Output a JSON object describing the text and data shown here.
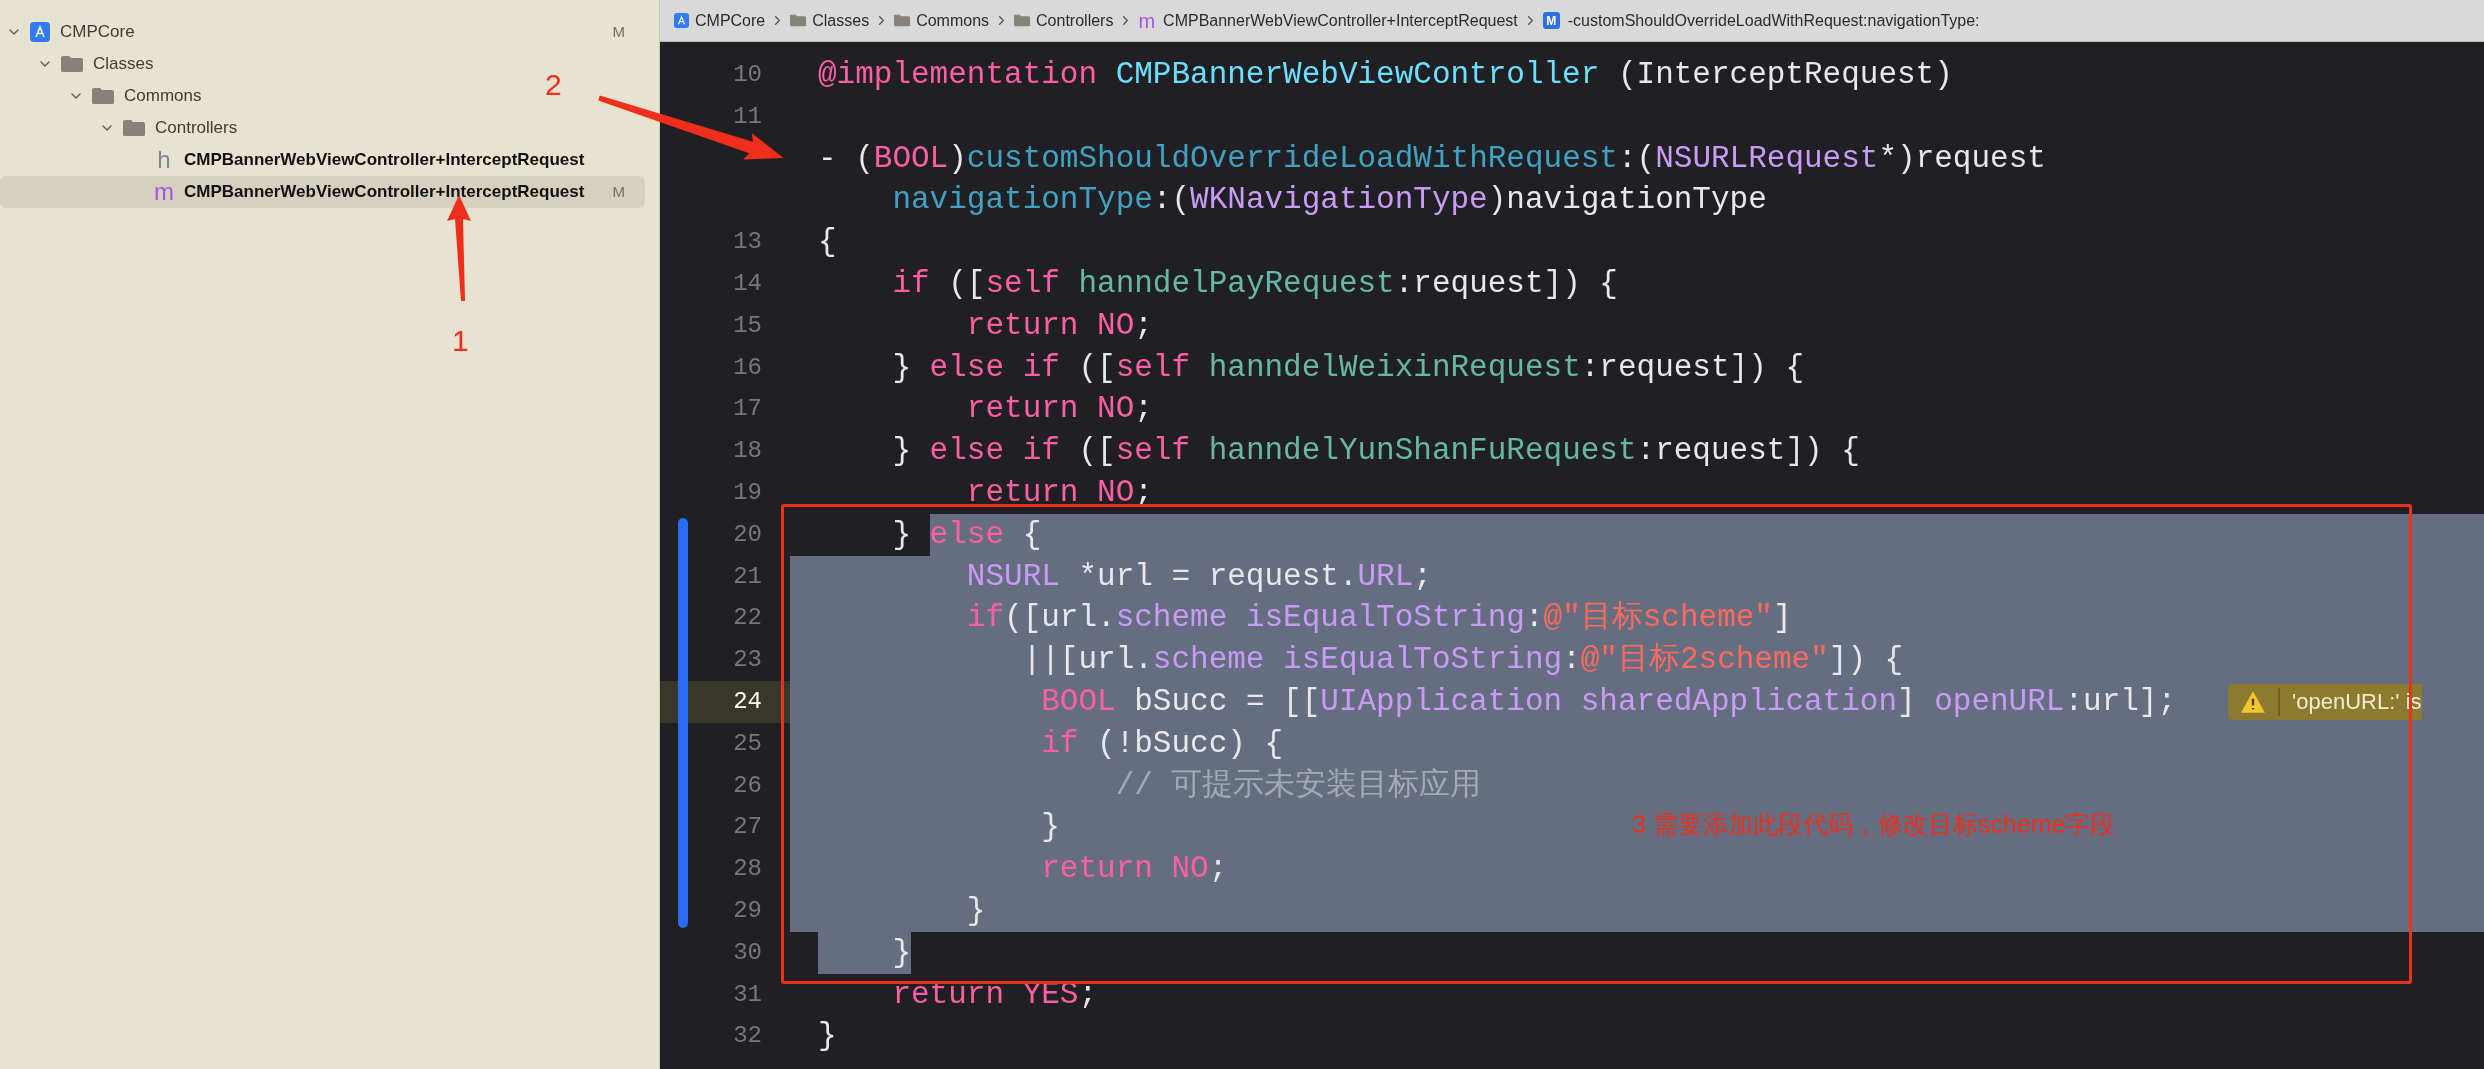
{
  "navigator": {
    "items": [
      {
        "label": "CMPCore",
        "kind": "project",
        "status": "M",
        "expanded": true,
        "selected": false,
        "children": [
          {
            "label": "Classes",
            "kind": "folder",
            "expanded": true,
            "selected": false,
            "children": [
              {
                "label": "Commons",
                "kind": "folder",
                "expanded": true,
                "selected": false,
                "children": [
                  {
                    "label": "Controllers",
                    "kind": "folder",
                    "expanded": true,
                    "selected": false,
                    "children": [
                      {
                        "label": "CMPBannerWebViewController+InterceptRequest",
                        "kind": "header",
                        "letter": "h",
                        "selected": false
                      },
                      {
                        "label": "CMPBannerWebViewController+InterceptRequest",
                        "kind": "implementation",
                        "letter": "m",
                        "status": "M",
                        "selected": true
                      }
                    ]
                  }
                ]
              }
            ]
          }
        ]
      }
    ]
  },
  "breadcrumb": [
    {
      "label": "CMPCore",
      "kind": "project"
    },
    {
      "label": "Classes",
      "kind": "folder"
    },
    {
      "label": "Commons",
      "kind": "folder"
    },
    {
      "label": "Controllers",
      "kind": "folder"
    },
    {
      "label": "CMPBannerWebViewController+InterceptRequest",
      "kind": "file",
      "letter": "m"
    },
    {
      "label": "-customShouldOverrideLoadWithRequest:navigationType:",
      "kind": "method",
      "letter": "M"
    }
  ],
  "editor": {
    "lines": [
      {
        "number": "10",
        "current": false,
        "changed": false,
        "tokens": [
          {
            "text": "@implementation",
            "kind": "keyword"
          },
          {
            "text": " CMPBannerWebViewController",
            "kind": "class"
          },
          {
            "text": " (InterceptRequest)",
            "kind": "plain"
          }
        ]
      },
      {
        "number": "11",
        "current": false,
        "changed": false
      },
      {
        "current": false,
        "changed": false,
        "tokens": [
          {
            "text": "- (",
            "kind": "plain"
          },
          {
            "text": "BOOL",
            "kind": "keyword"
          },
          {
            "text": ")",
            "kind": "plain"
          },
          {
            "text": "customShouldOverrideLoadWithRequest",
            "kind": "declaration"
          },
          {
            "text": ":(",
            "kind": "plain"
          },
          {
            "text": "NSURLRequest",
            "kind": "sdk"
          },
          {
            "text": "*)request",
            "kind": "plain"
          }
        ]
      },
      {
        "current": false,
        "changed": false,
        "tokens": [
          {
            "text": "    navigationType",
            "kind": "declaration"
          },
          {
            "text": ":(",
            "kind": "plain"
          },
          {
            "text": "WKNavigationType",
            "kind": "sdk"
          },
          {
            "text": ")navigationType",
            "kind": "plain"
          }
        ]
      },
      {
        "number": "13",
        "current": false,
        "changed": false,
        "tokens": [
          {
            "text": "{",
            "kind": "plain"
          }
        ]
      },
      {
        "number": "14",
        "current": false,
        "changed": false,
        "tokens": [
          {
            "text": "    if",
            "kind": "keyword"
          },
          {
            "text": " ([",
            "kind": "plain"
          },
          {
            "text": "self",
            "kind": "keyword"
          },
          {
            "text": " hanndelPayRequest",
            "kind": "method"
          },
          {
            "text": ":request]) {",
            "kind": "plain"
          }
        ]
      },
      {
        "number": "15",
        "current": false,
        "changed": false,
        "tokens": [
          {
            "text": "        return",
            "kind": "keyword"
          },
          {
            "text": " NO",
            "kind": "keyword"
          },
          {
            "text": ";",
            "kind": "plain"
          }
        ]
      },
      {
        "number": "16",
        "current": false,
        "changed": false,
        "tokens": [
          {
            "text": "    }",
            "kind": "plain"
          },
          {
            "text": " else if",
            "kind": "keyword"
          },
          {
            "text": " ([",
            "kind": "plain"
          },
          {
            "text": "self",
            "kind": "keyword"
          },
          {
            "text": " hanndelWeixinRequest",
            "kind": "method"
          },
          {
            "text": ":request]) {",
            "kind": "plain"
          }
        ]
      },
      {
        "number": "17",
        "current": false,
        "changed": false,
        "tokens": [
          {
            "text": "        return",
            "kind": "keyword"
          },
          {
            "text": " NO",
            "kind": "keyword"
          },
          {
            "text": ";",
            "kind": "plain"
          }
        ]
      },
      {
        "number": "18",
        "current": false,
        "changed": false,
        "tokens": [
          {
            "text": "    }",
            "kind": "plain"
          },
          {
            "text": " else if",
            "kind": "keyword"
          },
          {
            "text": " ([",
            "kind": "plain"
          },
          {
            "text": "self",
            "kind": "keyword"
          },
          {
            "text": " hanndelYunShanFuRequest",
            "kind": "method"
          },
          {
            "text": ":request]) {",
            "kind": "plain"
          }
        ]
      },
      {
        "number": "19",
        "current": false,
        "changed": false,
        "tokens": [
          {
            "text": "        return",
            "kind": "keyword"
          },
          {
            "text": " NO",
            "kind": "keyword"
          },
          {
            "text": ";",
            "kind": "plain"
          }
        ]
      },
      {
        "number": "20",
        "selected": true,
        "line_end_selected": true,
        "current": false,
        "changed": true,
        "lead": [
          {
            "text": "    }",
            "kind": "plain"
          }
        ],
        "tokens": [
          {
            "text": "else",
            "kind": "keyword"
          },
          {
            "text": " {",
            "kind": "plain"
          }
        ]
      },
      {
        "number": "21",
        "selected": true,
        "line_end_selected": true,
        "current": false,
        "changed": true,
        "tokens": [
          {
            "text": "        NSURL",
            "kind": "sdk"
          },
          {
            "text": " *url = request.",
            "kind": "plain"
          },
          {
            "text": "URL",
            "kind": "sdk"
          },
          {
            "text": ";",
            "kind": "plain"
          }
        ]
      },
      {
        "number": "22",
        "selected": true,
        "line_end_selected": true,
        "current": false,
        "changed": true,
        "tokens": [
          {
            "text": "        if",
            "kind": "keyword"
          },
          {
            "text": "([url.",
            "kind": "plain"
          },
          {
            "text": "scheme",
            "kind": "sdk"
          },
          {
            "text": " isEqualToString",
            "kind": "sdk"
          },
          {
            "text": ":",
            "kind": "plain"
          },
          {
            "text": "@\"目标scheme\"",
            "kind": "string"
          },
          {
            "text": "]",
            "kind": "plain"
          }
        ]
      },
      {
        "number": "23",
        "selected": true,
        "line_end_selected": true,
        "current": false,
        "changed": true,
        "tokens": [
          {
            "text": "           ||[url.",
            "kind": "plain"
          },
          {
            "text": "scheme",
            "kind": "sdk"
          },
          {
            "text": " isEqualToString",
            "kind": "sdk"
          },
          {
            "text": ":",
            "kind": "plain"
          },
          {
            "text": "@\"目标2scheme\"",
            "kind": "string"
          },
          {
            "text": "]) {",
            "kind": "plain"
          }
        ]
      },
      {
        "number": "24",
        "selected": true,
        "line_end_selected": true,
        "current": true,
        "changed": true,
        "warning": "'openURL:' is",
        "tokens": [
          {
            "text": "            BOOL",
            "kind": "keyword"
          },
          {
            "text": " bSucc = [[",
            "kind": "plain"
          },
          {
            "text": "UIApplication",
            "kind": "sdk"
          },
          {
            "text": " sharedApplication",
            "kind": "sdk"
          },
          {
            "text": "]",
            "kind": "plain"
          },
          {
            "text": " openURL",
            "kind": "sdk"
          },
          {
            "text": ":url];",
            "kind": "plain"
          }
        ]
      },
      {
        "number": "25",
        "selected": true,
        "line_end_selected": true,
        "current": false,
        "changed": true,
        "tokens": [
          {
            "text": "            if",
            "kind": "keyword"
          },
          {
            "text": " (!bSucc) {",
            "kind": "plain"
          }
        ]
      },
      {
        "number": "26",
        "selected": true,
        "line_end_selected": true,
        "current": false,
        "changed": true,
        "tokens": [
          {
            "text": "                // 可提示未安装目标应用",
            "kind": "comment"
          }
        ]
      },
      {
        "number": "27",
        "selected": true,
        "line_end_selected": true,
        "current": false,
        "changed": true,
        "tokens": [
          {
            "text": "            }",
            "kind": "plain"
          }
        ]
      },
      {
        "number": "28",
        "selected": true,
        "line_end_selected": true,
        "current": false,
        "changed": true,
        "tokens": [
          {
            "text": "            return",
            "kind": "keyword"
          },
          {
            "text": " NO",
            "kind": "keyword"
          },
          {
            "text": ";",
            "kind": "plain"
          }
        ]
      },
      {
        "number": "29",
        "selected": true,
        "line_end_selected": true,
        "current": false,
        "changed": true,
        "tokens": [
          {
            "text": "        }",
            "kind": "plain"
          }
        ]
      },
      {
        "number": "30",
        "selected": true,
        "line_end_selected": false,
        "current": false,
        "changed": false,
        "tokens": [
          {
            "text": "    }",
            "kind": "plain"
          }
        ]
      },
      {
        "number": "31",
        "current": false,
        "changed": false,
        "tokens": [
          {
            "text": "    return",
            "kind": "keyword"
          },
          {
            "text": " YES",
            "kind": "keyword"
          },
          {
            "text": ";",
            "kind": "plain"
          }
        ]
      },
      {
        "number": "32",
        "current": false,
        "changed": false,
        "tokens": [
          {
            "text": "}",
            "kind": "plain"
          }
        ]
      }
    ]
  },
  "annotations": {
    "labels": [
      "1",
      "2"
    ],
    "note": "3 需要添加此段代码，修改目标scheme字段"
  }
}
